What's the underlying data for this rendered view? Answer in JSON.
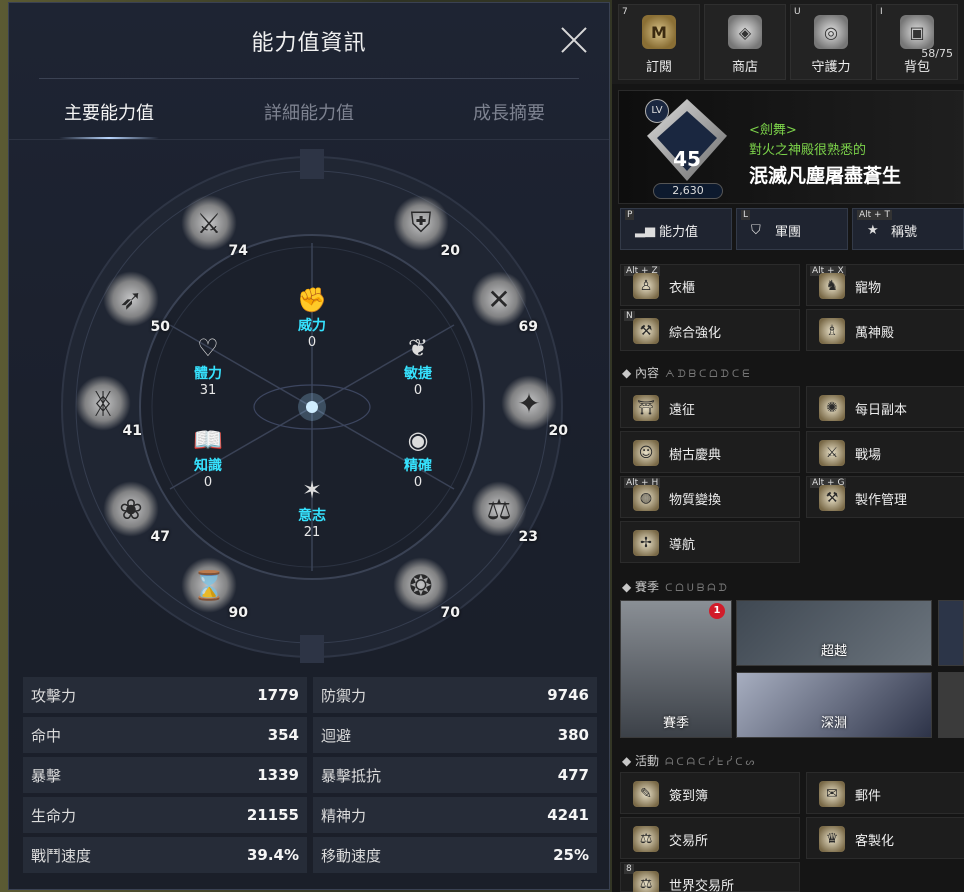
{
  "panel": {
    "title": "能力值資訊",
    "tabs": [
      "主要能力值",
      "詳細能力值",
      "成長摘要"
    ]
  },
  "wheel": {
    "outer": [
      {
        "name": "sword-emblem",
        "value": "74"
      },
      {
        "name": "helmet-emblem",
        "value": "20"
      },
      {
        "name": "crossed-blades-emblem",
        "value": "69"
      },
      {
        "name": "star-emblem",
        "value": "20"
      },
      {
        "name": "scales-emblem",
        "value": "23"
      },
      {
        "name": "flame-emblem",
        "value": "70"
      },
      {
        "name": "hourglass-emblem",
        "value": "90"
      },
      {
        "name": "tree-emblem",
        "value": "47"
      },
      {
        "name": "butterfly-emblem",
        "value": "41"
      },
      {
        "name": "bow-emblem",
        "value": "50"
      }
    ],
    "main": [
      {
        "name": "威力",
        "value": "0",
        "icon": "✊"
      },
      {
        "name": "敏捷",
        "value": "0",
        "icon": "❦"
      },
      {
        "name": "精確",
        "value": "0",
        "icon": "◉"
      },
      {
        "name": "意志",
        "value": "21",
        "icon": "✶"
      },
      {
        "name": "知識",
        "value": "0",
        "icon": "📖"
      },
      {
        "name": "體力",
        "value": "31",
        "icon": "♡"
      }
    ]
  },
  "stats": [
    {
      "l1": "攻擊力",
      "v1": "1779",
      "l2": "防禦力",
      "v2": "9746"
    },
    {
      "l1": "命中",
      "v1": "354",
      "l2": "迴避",
      "v2": "380"
    },
    {
      "l1": "暴擊",
      "v1": "1339",
      "l2": "暴擊抵抗",
      "v2": "477"
    },
    {
      "l1": "生命力",
      "v1": "21155",
      "l2": "精神力",
      "v2": "4241"
    },
    {
      "l1": "戰鬥速度",
      "v1": "39.4%",
      "l2": "移動速度",
      "v2": "25%"
    }
  ],
  "topbar": [
    {
      "key": "7",
      "label": "訂閱",
      "icon": "M"
    },
    {
      "key": "",
      "label": "商店",
      "icon": "◈"
    },
    {
      "key": "U",
      "label": "守護力",
      "icon": "◎"
    },
    {
      "key": "I",
      "label": "背包",
      "icon": "▣",
      "count": "58/75"
    }
  ],
  "profile": {
    "lv_label": "LV",
    "level": "45",
    "power": "2,630",
    "class": "<劍舞>",
    "title": "對火之神殿很熟悉的",
    "name": "泯滅凡塵屠盡蒼生"
  },
  "menu3": [
    {
      "key": "P",
      "label": "能力值"
    },
    {
      "key": "L",
      "label": "軍團"
    },
    {
      "key": "Alt + T",
      "label": "稱號"
    }
  ],
  "buttons_top": [
    {
      "key": "Alt + Z",
      "label": "衣櫃"
    },
    {
      "key": "Alt + X",
      "label": "寵物"
    },
    {
      "key": "N",
      "label": "綜合強化"
    },
    {
      "key": "",
      "label": "萬神殿"
    }
  ],
  "sections": {
    "content": "內容",
    "content_deco": "ᗅᗪᗷᑕᗝᗪᑕᗴ",
    "season": "賽季",
    "season_deco": "ᑕᗝᑌᗷᗩᗪ",
    "activity": "活動",
    "activity_deco": "ᗩᑕᗩᑕᓰᖶᓰᑕᔕ"
  },
  "buttons_content": [
    {
      "key": "",
      "label": "遠征"
    },
    {
      "key": "",
      "label": "每日副本"
    },
    {
      "key": "",
      "label": "樹古慶典"
    },
    {
      "key": "",
      "label": "戰場"
    },
    {
      "key": "Alt + H",
      "label": "物質變換"
    },
    {
      "key": "Alt + G",
      "label": "製作管理"
    },
    {
      "key": "",
      "label": "導航"
    }
  ],
  "season_cards": [
    {
      "label": "賽季",
      "badge": "1"
    },
    {
      "label": "超越"
    },
    {
      "label": "深淵"
    }
  ],
  "buttons_activity": [
    {
      "key": "",
      "label": "簽到簿"
    },
    {
      "key": "",
      "label": "郵件"
    },
    {
      "key": "",
      "label": "交易所"
    },
    {
      "key": "",
      "label": "客製化"
    },
    {
      "key": "8",
      "label": "世界交易所"
    }
  ]
}
